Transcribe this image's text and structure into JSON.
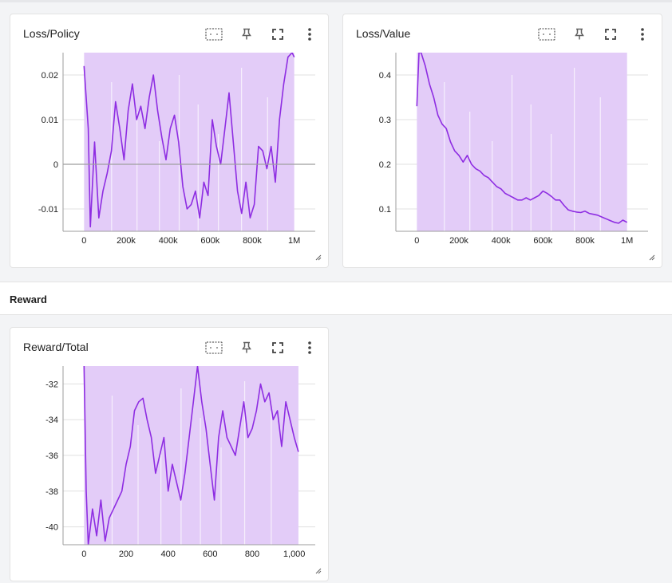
{
  "section": {
    "title": "Reward"
  },
  "toolbar_icons": [
    "fit-domain-icon",
    "pin-icon",
    "fullscreen-icon",
    "more-vert-icon"
  ],
  "colors": {
    "line": "#8e2de2",
    "band": "#e3ccf8",
    "band_streak": "#ffffff",
    "axis": "#9e9e9e",
    "grid": "#e0e0e0"
  },
  "cards": [
    {
      "title": "Loss/Policy"
    },
    {
      "title": "Loss/Value"
    },
    {
      "title": "Reward/Total"
    }
  ],
  "chart_data": [
    {
      "type": "line",
      "title": "Loss/Policy",
      "xlabel": "",
      "ylabel": "",
      "xlim": [
        -100000,
        1100000
      ],
      "ylim": [
        -0.015,
        0.025
      ],
      "x_ticks": [
        {
          "v": 0,
          "label": "0"
        },
        {
          "v": 200000,
          "label": "200k"
        },
        {
          "v": 400000,
          "label": "400k"
        },
        {
          "v": 600000,
          "label": "600k"
        },
        {
          "v": 800000,
          "label": "800k"
        },
        {
          "v": 1000000,
          "label": "1M"
        }
      ],
      "y_ticks": [
        {
          "v": 0.02,
          "label": "0.02"
        },
        {
          "v": 0.01,
          "label": "0.01"
        },
        {
          "v": 0,
          "label": "0"
        },
        {
          "v": -0.01,
          "label": "-0.01"
        }
      ],
      "zero_line": 0,
      "band_x": [
        0,
        1000000
      ],
      "series": [
        {
          "x": [
            0,
            20000,
            30000,
            50000,
            70000,
            90000,
            110000,
            130000,
            150000,
            170000,
            190000,
            210000,
            230000,
            250000,
            270000,
            290000,
            310000,
            330000,
            350000,
            370000,
            390000,
            410000,
            430000,
            450000,
            470000,
            490000,
            510000,
            530000,
            550000,
            570000,
            590000,
            610000,
            630000,
            650000,
            670000,
            690000,
            710000,
            730000,
            750000,
            770000,
            790000,
            810000,
            830000,
            850000,
            870000,
            890000,
            910000,
            930000,
            950000,
            970000,
            990000,
            1000000
          ],
          "y": [
            0.022,
            0.008,
            -0.014,
            0.005,
            -0.012,
            -0.006,
            -0.002,
            0.003,
            0.014,
            0.008,
            0.001,
            0.012,
            0.018,
            0.01,
            0.013,
            0.008,
            0.015,
            0.02,
            0.012,
            0.006,
            0.001,
            0.008,
            0.011,
            0.005,
            -0.005,
            -0.01,
            -0.009,
            -0.006,
            -0.012,
            -0.004,
            -0.007,
            0.01,
            0.004,
            0.0,
            0.008,
            0.016,
            0.005,
            -0.006,
            -0.011,
            -0.004,
            -0.012,
            -0.009,
            0.004,
            0.003,
            -0.001,
            0.004,
            -0.004,
            0.01,
            0.018,
            0.024,
            0.025,
            0.024
          ]
        }
      ]
    },
    {
      "type": "line",
      "title": "Loss/Value",
      "xlabel": "",
      "ylabel": "",
      "xlim": [
        -100000,
        1100000
      ],
      "ylim": [
        0.05,
        0.45
      ],
      "x_ticks": [
        {
          "v": 0,
          "label": "0"
        },
        {
          "v": 200000,
          "label": "200k"
        },
        {
          "v": 400000,
          "label": "400k"
        },
        {
          "v": 600000,
          "label": "600k"
        },
        {
          "v": 800000,
          "label": "800k"
        },
        {
          "v": 1000000,
          "label": "1M"
        }
      ],
      "y_ticks": [
        {
          "v": 0.4,
          "label": "0.4"
        },
        {
          "v": 0.3,
          "label": "0.3"
        },
        {
          "v": 0.2,
          "label": "0.2"
        },
        {
          "v": 0.1,
          "label": "0.1"
        }
      ],
      "band_x": [
        0,
        1000000
      ],
      "series": [
        {
          "x": [
            0,
            10000,
            20000,
            40000,
            60000,
            80000,
            100000,
            120000,
            140000,
            160000,
            180000,
            200000,
            220000,
            240000,
            260000,
            280000,
            300000,
            320000,
            340000,
            360000,
            380000,
            400000,
            420000,
            440000,
            460000,
            480000,
            500000,
            520000,
            540000,
            560000,
            580000,
            600000,
            620000,
            640000,
            660000,
            680000,
            700000,
            720000,
            740000,
            760000,
            780000,
            800000,
            820000,
            840000,
            860000,
            880000,
            900000,
            920000,
            940000,
            960000,
            980000,
            1000000
          ],
          "y": [
            0.33,
            0.45,
            0.45,
            0.42,
            0.38,
            0.35,
            0.31,
            0.29,
            0.28,
            0.25,
            0.23,
            0.22,
            0.205,
            0.22,
            0.2,
            0.19,
            0.185,
            0.175,
            0.17,
            0.16,
            0.15,
            0.145,
            0.135,
            0.13,
            0.125,
            0.12,
            0.12,
            0.125,
            0.12,
            0.125,
            0.13,
            0.14,
            0.135,
            0.128,
            0.12,
            0.12,
            0.108,
            0.098,
            0.095,
            0.093,
            0.092,
            0.095,
            0.09,
            0.088,
            0.086,
            0.082,
            0.078,
            0.074,
            0.07,
            0.068,
            0.075,
            0.07
          ]
        }
      ]
    },
    {
      "type": "line",
      "title": "Reward/Total",
      "xlabel": "",
      "ylabel": "",
      "xlim": [
        -100,
        1100
      ],
      "ylim": [
        -41,
        -31
      ],
      "x_ticks": [
        {
          "v": 0,
          "label": "0"
        },
        {
          "v": 200,
          "label": "200"
        },
        {
          "v": 400,
          "label": "400"
        },
        {
          "v": 600,
          "label": "600"
        },
        {
          "v": 800,
          "label": "800"
        },
        {
          "v": 1000,
          "label": "1,000"
        }
      ],
      "y_ticks": [
        {
          "v": -32,
          "label": "-32"
        },
        {
          "v": -34,
          "label": "-34"
        },
        {
          "v": -36,
          "label": "-36"
        },
        {
          "v": -38,
          "label": "-38"
        },
        {
          "v": -40,
          "label": "-40"
        }
      ],
      "band_x": [
        0,
        1020
      ],
      "series": [
        {
          "x": [
            0,
            10,
            20,
            40,
            60,
            80,
            100,
            120,
            140,
            160,
            180,
            200,
            220,
            240,
            260,
            280,
            300,
            320,
            340,
            360,
            380,
            400,
            420,
            440,
            460,
            480,
            500,
            520,
            540,
            560,
            580,
            600,
            620,
            640,
            660,
            680,
            700,
            720,
            740,
            760,
            780,
            800,
            820,
            840,
            860,
            880,
            900,
            920,
            940,
            960,
            980,
            1000,
            1020
          ],
          "y": [
            -31,
            -38,
            -41,
            -39,
            -40.5,
            -38.5,
            -40.8,
            -39.5,
            -39,
            -38.5,
            -38,
            -36.5,
            -35.5,
            -33.5,
            -33,
            -32.8,
            -34,
            -35,
            -37,
            -36,
            -35,
            -38,
            -36.5,
            -37.5,
            -38.5,
            -37,
            -35,
            -33,
            -31,
            -33,
            -34.5,
            -36.5,
            -38.5,
            -35,
            -33.5,
            -35,
            -35.5,
            -36,
            -34.5,
            -33,
            -35,
            -34.5,
            -33.5,
            -32,
            -33,
            -32.5,
            -34,
            -33.5,
            -35.5,
            -33,
            -34,
            -35,
            -35.8
          ]
        }
      ]
    }
  ]
}
